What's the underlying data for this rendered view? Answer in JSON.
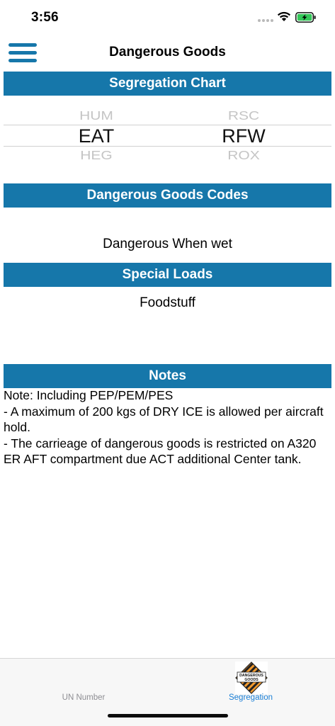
{
  "status_bar": {
    "time": "3:56"
  },
  "nav": {
    "title": "Dangerous Goods"
  },
  "segregation": {
    "header": "Segregation Chart",
    "left_column": {
      "above": "HUM",
      "selected": "EAT",
      "below": "HEG"
    },
    "right_column": {
      "above": "RSC",
      "selected": "RFW",
      "below": "ROX"
    }
  },
  "dg_codes": {
    "header": "Dangerous Goods Codes",
    "value": "Dangerous When wet"
  },
  "special_loads": {
    "header": "Special Loads",
    "value": "Foodstuff"
  },
  "notes": {
    "header": "Notes",
    "text": "Note: Including PEP/PEM/PES\n- A maximum of 200 kgs of DRY ICE is allowed per aircraft hold.\n- The carrieage of dangerous goods is restricted on A320 ER AFT compartment due ACT additional Center tank."
  },
  "tabs": [
    {
      "label": "UN Number",
      "selected": false
    },
    {
      "label": "Segregation",
      "selected": true,
      "icon": "dangerous-goods-label-icon",
      "icon_text": [
        "DANGEROUS",
        "GOODS"
      ]
    }
  ],
  "colors": {
    "accent": "#1677aa",
    "tab_selected": "#1a7fd6",
    "tab_unselected": "#8e8e93",
    "battery": "#34c759"
  }
}
